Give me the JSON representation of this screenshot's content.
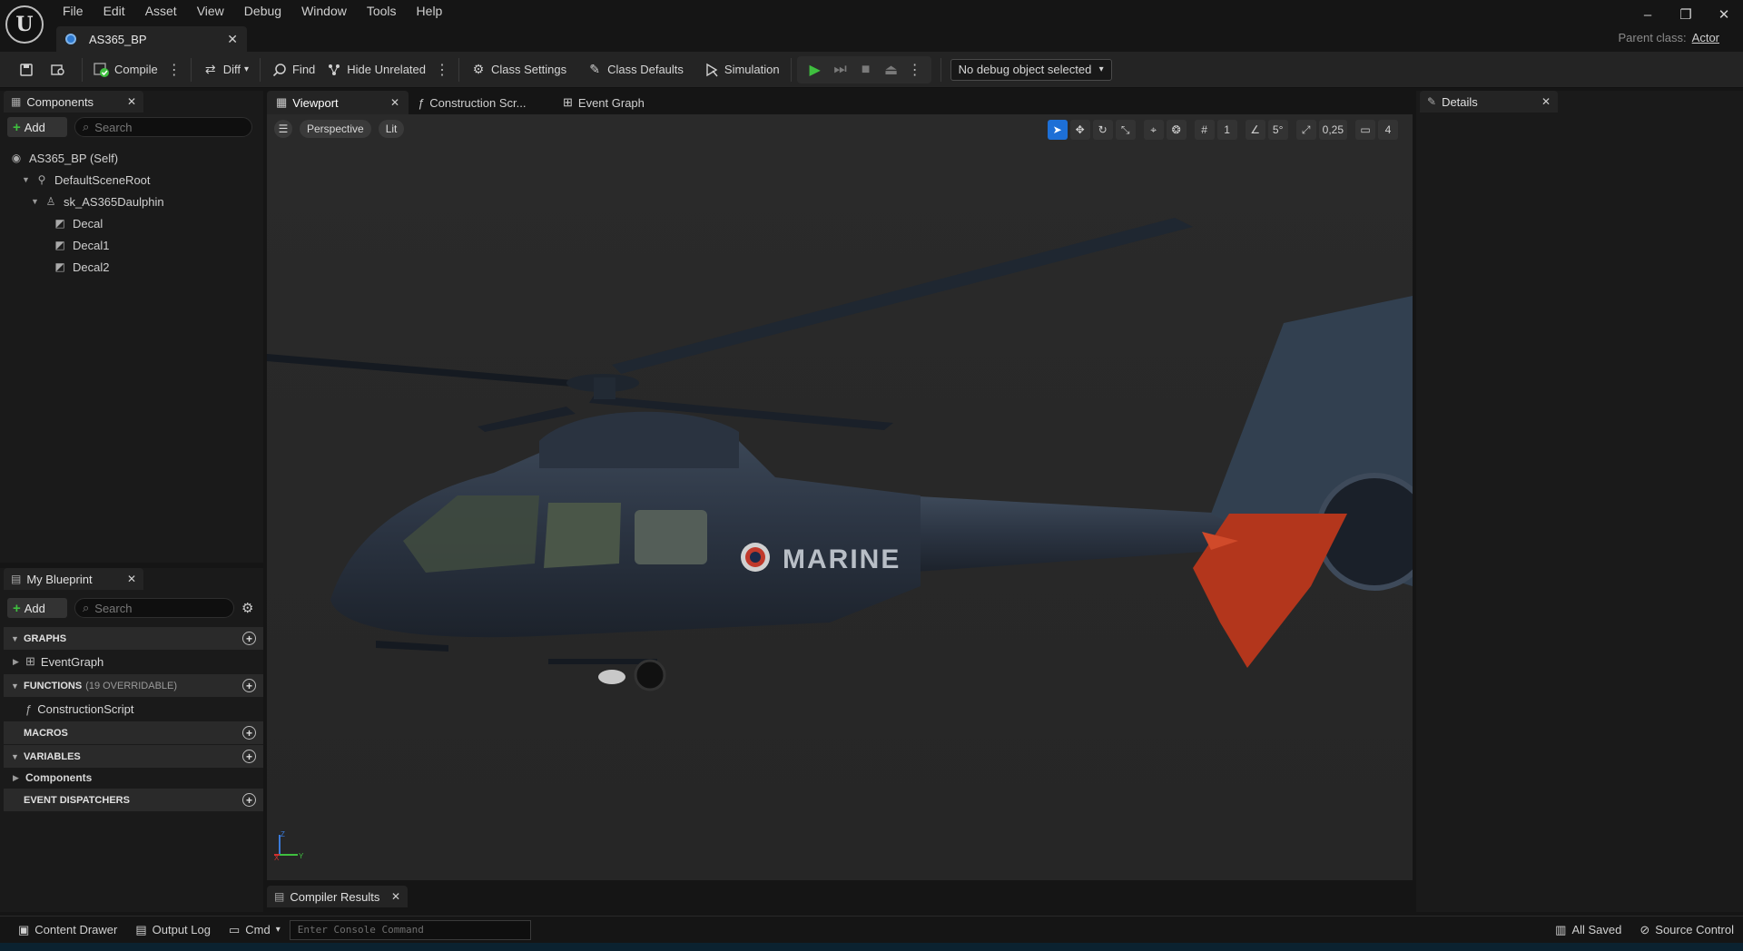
{
  "window": {
    "menu": [
      "File",
      "Edit",
      "Asset",
      "View",
      "Debug",
      "Window",
      "Tools",
      "Help"
    ],
    "document_tab": "AS365_BP",
    "parent_class_label": "Parent class:",
    "parent_class_value": "Actor"
  },
  "toolbar": {
    "compile": "Compile",
    "diff": "Diff",
    "find": "Find",
    "hide_unrelated": "Hide Unrelated",
    "class_settings": "Class Settings",
    "class_defaults": "Class Defaults",
    "simulation": "Simulation",
    "debug_object": "No debug object selected"
  },
  "components": {
    "tab": "Components",
    "add": "Add",
    "search_placeholder": "Search",
    "items": [
      "AS365_BP (Self)",
      "DefaultSceneRoot",
      "sk_AS365Daulphin",
      "Decal",
      "Decal1",
      "Decal2"
    ]
  },
  "my_blueprint": {
    "tab": "My Blueprint",
    "add": "Add",
    "search_placeholder": "Search",
    "graphs": "GRAPHS",
    "event_graph": "EventGraph",
    "functions": "FUNCTIONS",
    "functions_count": "(19 OVERRIDABLE)",
    "construction_script": "ConstructionScript",
    "macros": "MACROS",
    "variables": "VARIABLES",
    "components": "Components",
    "event_dispatchers": "EVENT DISPATCHERS"
  },
  "editor_tabs": [
    "Viewport",
    "Construction Scr...",
    "Event Graph"
  ],
  "viewport": {
    "perspective": "Perspective",
    "lit": "Lit",
    "grid_value": "1",
    "angle_value": "5°",
    "scale_value": "0,25",
    "camera_speed": "4",
    "fuselage_text": "MARINE",
    "axis_x": "X",
    "axis_y": "Y",
    "axis_z": "Z"
  },
  "details": {
    "tab": "Details"
  },
  "compiler_results": {
    "tab": "Compiler Results"
  },
  "statusbar": {
    "content_drawer": "Content Drawer",
    "output_log": "Output Log",
    "cmd": "Cmd",
    "console_placeholder": "Enter Console Command",
    "all_saved": "All Saved",
    "source_control": "Source Control"
  },
  "colors": {
    "accent_blue": "#1d6fd6",
    "play_green": "#3fbf3f",
    "helicopter_body": "#2b3442",
    "tail_fin": "#b3361c"
  }
}
